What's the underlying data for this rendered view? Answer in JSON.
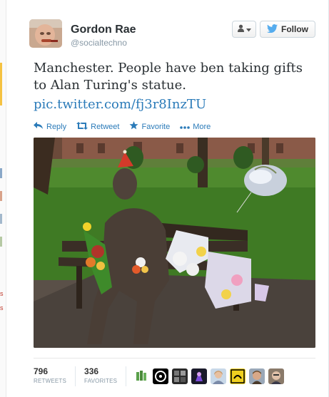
{
  "user": {
    "fullname": "Gordon Rae",
    "username": "@socialtechno"
  },
  "follow_button": {
    "label": "Follow"
  },
  "tweet": {
    "text": "Manchester. People have ben taking gifts to Alan Turing's statue.",
    "link": "pic.twitter.com/fj3r8InzTU"
  },
  "actions": {
    "reply": "Reply",
    "retweet": "Retweet",
    "favorite": "Favorite",
    "more": "More"
  },
  "stats": {
    "retweets": {
      "count": "796",
      "label": "RETWEETS"
    },
    "favorites": {
      "count": "336",
      "label": "FAVORITES"
    }
  },
  "left_strip_chars": [
    "s",
    "s"
  ],
  "colors": {
    "link": "#2b7bb9",
    "name": "#292f33",
    "muted": "#8899a6"
  },
  "icons": [
    "reply-icon",
    "retweet-icon",
    "star-icon",
    "more-dots-icon",
    "twitter-bird-icon",
    "user-icon",
    "caret-down-icon"
  ]
}
